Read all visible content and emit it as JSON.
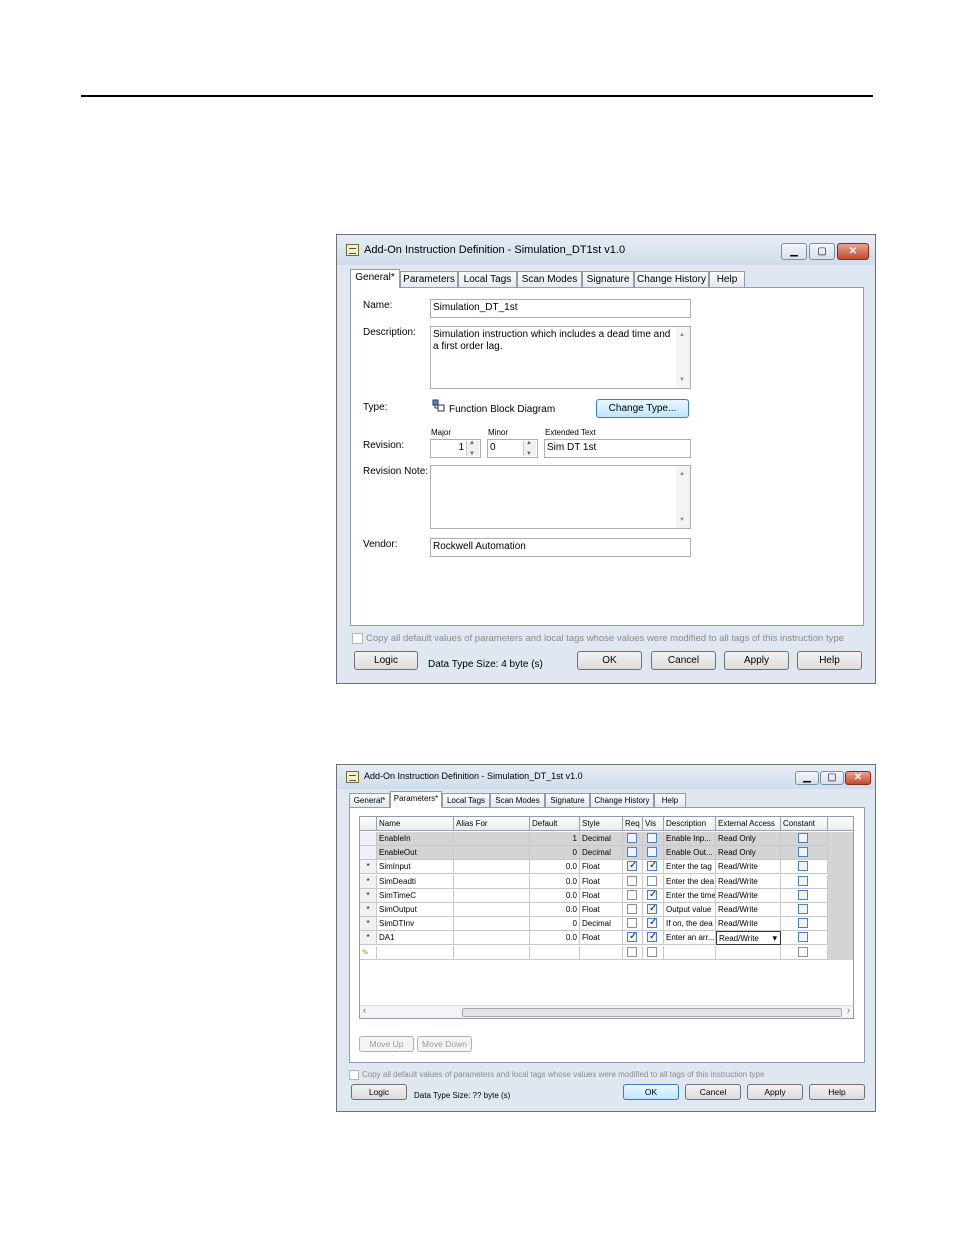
{
  "dialog1": {
    "title": "Add-On Instruction Definition - Simulation_DT1st v1.0",
    "tabs": [
      "General*",
      "Parameters",
      "Local Tags",
      "Scan Modes",
      "Signature",
      "Change History",
      "Help"
    ],
    "name_label": "Name:",
    "name_value": "Simulation_DT_1st",
    "description_label": "Description:",
    "description_value": "Simulation instruction which includes a dead time and a first order lag.",
    "type_label": "Type:",
    "type_value": "Function Block Diagram",
    "change_type_button": "Change Type...",
    "major_label": "Major",
    "minor_label": "Minor",
    "extended_text_label": "Extended Text",
    "revision_label": "Revision:",
    "major_value": "1",
    "minor_value": "0",
    "extended_text_value": "Sim DT 1st",
    "revision_note_label": "Revision Note:",
    "revision_note_value": "",
    "vendor_label": "Vendor:",
    "vendor_value": "Rockwell Automation",
    "copy_defaults_label": "Copy all default values of parameters and local tags whose values were modified to all tags of this instruction type",
    "logic_button": "Logic",
    "data_type_size": "Data Type Size: 4 byte (s)",
    "ok_button": "OK",
    "cancel_button": "Cancel",
    "apply_button": "Apply",
    "help_button": "Help"
  },
  "dialog2": {
    "title": "Add-On Instruction Definition - Simulation_DT_1st v1.0",
    "tabs": [
      "General*",
      "Parameters*",
      "Local Tags",
      "Scan Modes",
      "Signature",
      "Change History",
      "Help"
    ],
    "columns": [
      "Name",
      "Alias For",
      "Default",
      "Style",
      "Req",
      "Vis",
      "Description",
      "External Access",
      "Constant"
    ],
    "rows": [
      {
        "marker": "",
        "name": "EnableIn",
        "alias": "",
        "default": "1",
        "style": "Decimal",
        "req": false,
        "vis": false,
        "description": "Enable Inp...",
        "access": "Read Only",
        "constant": false,
        "gray": true
      },
      {
        "marker": "",
        "name": "EnableOut",
        "alias": "",
        "default": "0",
        "style": "Decimal",
        "req": false,
        "vis": false,
        "description": "Enable Out...",
        "access": "Read Only",
        "constant": false,
        "gray": true
      },
      {
        "marker": "*",
        "name": "SimInput",
        "alias": "",
        "default": "0.0",
        "style": "Float",
        "req": true,
        "vis": true,
        "description": "Enter the tag",
        "access": "Read/Write",
        "constant": false,
        "gray": false
      },
      {
        "marker": "*",
        "name": "SimDeadti",
        "alias": "",
        "default": "0.0",
        "style": "Float",
        "req": false,
        "vis": false,
        "description": "Enter the dea",
        "access": "Read/Write",
        "constant": false,
        "gray": false
      },
      {
        "marker": "*",
        "name": "SimTimeC",
        "alias": "",
        "default": "0.0",
        "style": "Float",
        "req": false,
        "vis": true,
        "description": "Enter the time",
        "access": "Read/Write",
        "constant": false,
        "gray": false
      },
      {
        "marker": "*",
        "name": "SimOutput",
        "alias": "",
        "default": "0.0",
        "style": "Float",
        "req": false,
        "vis": true,
        "description": "Output value",
        "access": "Read/Write",
        "constant": false,
        "gray": false
      },
      {
        "marker": "*",
        "name": "SimDTInv",
        "alias": "",
        "default": "0",
        "style": "Decimal",
        "req": false,
        "vis": true,
        "description": "If on, the dea",
        "access": "Read/Write",
        "constant": false,
        "gray": false
      },
      {
        "marker": "*",
        "name": "DA1",
        "alias": "",
        "default": "0.0",
        "style": "Float",
        "req": true,
        "vis": true,
        "description": "Enter an arr...",
        "access": "Read/Write",
        "constant": false,
        "gray": false
      }
    ],
    "move_up_button": "Move Up",
    "move_down_button": "Move Down",
    "copy_defaults_label": "Copy all default values of parameters and local tags whose values were modified to all tags of this instruction type",
    "logic_button": "Logic",
    "data_type_size": "Data Type Size: ?? byte (s)",
    "ok_button": "OK",
    "cancel_button": "Cancel",
    "apply_button": "Apply",
    "help_button": "Help"
  }
}
